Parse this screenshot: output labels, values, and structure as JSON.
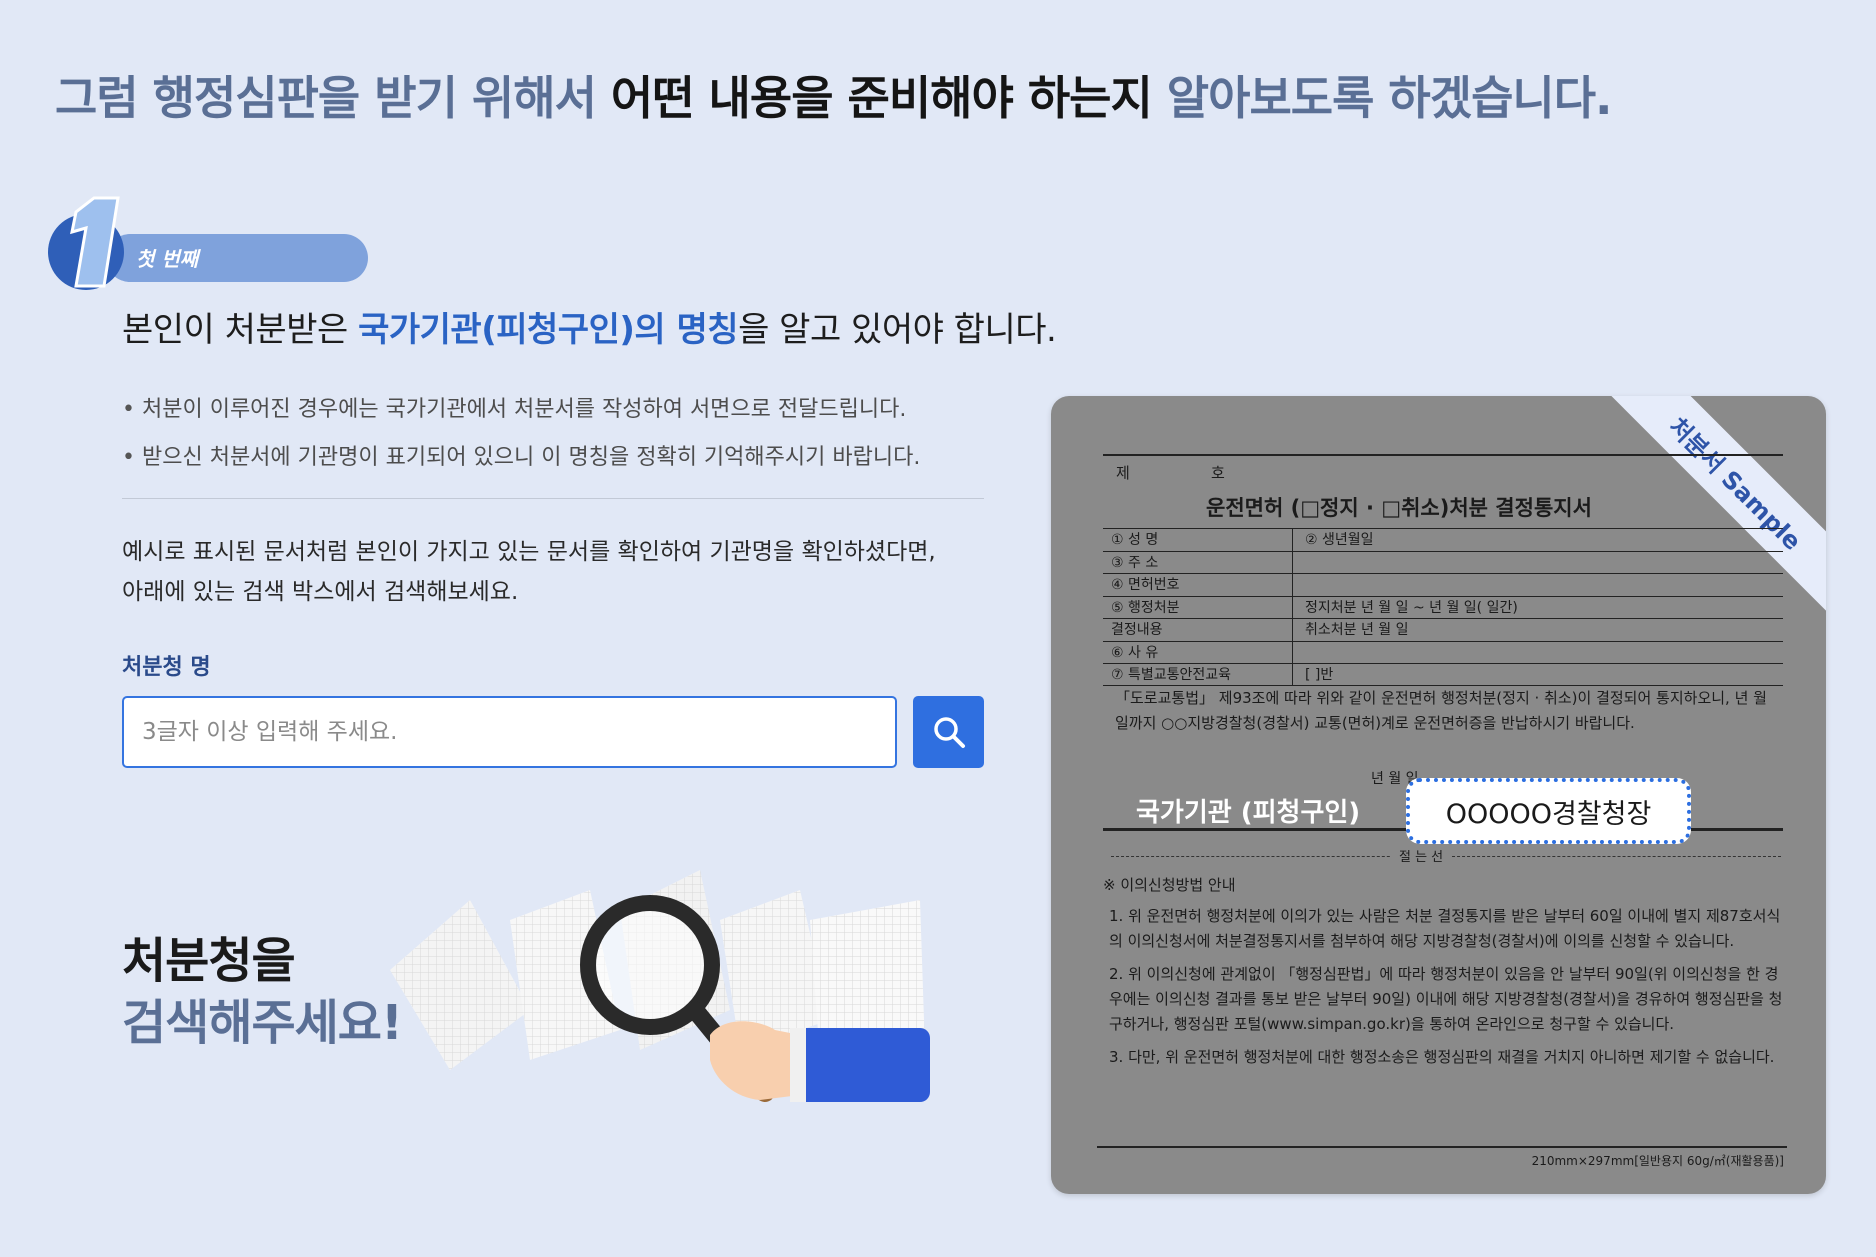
{
  "headline": {
    "part1": "그럼 행정심판을 받기 위해서 ",
    "part2": "어떤 내용을 준비해야 하는지",
    "part3": " 알아보도록 하겠습니다."
  },
  "step": {
    "number": "1",
    "label": "첫 번째"
  },
  "lead": {
    "prefix": "본인이 처분받은 ",
    "highlight": "국가기관(피청구인)의 명칭",
    "suffix": "을 알고 있어야 합니다."
  },
  "bullets": [
    "처분이 이루어진 경우에는 국가기관에서 처분서를 작성하여 서면으로 전달드립니다.",
    "받으신 처분서에 기관명이 표기되어 있으니 이 명칭을 정확히 기억해주시기 바랍니다."
  ],
  "example_text": {
    "line1": "예시로 표시된 문서처럼 본인이 가지고 있는 문서를 확인하여 기관명을 확인하셨다면,",
    "line2": "아래에 있는 검색 박스에서 검색해보세요."
  },
  "search": {
    "label": "처분청 명",
    "placeholder": "3글자 이상 입력해 주세요.",
    "value": "",
    "button_icon": "search-icon"
  },
  "cta": {
    "line1": "처분청을",
    "line2": "검색해주세요!"
  },
  "sample": {
    "ribbon": "처분서 Sample",
    "doc_no": "제",
    "doc_ho": "호",
    "doc_title": "운전면허 (□정지 · □취소)처분 결정통지서",
    "rows": [
      {
        "c1": "① 성 명",
        "c2": "② 생년월일"
      },
      {
        "c1": "③ 주 소",
        "c2": ""
      },
      {
        "c1": "④ 면허번호",
        "c2": ""
      },
      {
        "c1": "⑤ 행정처분",
        "c2": "정지처분     년   월   일 ~   년   월   일(   일간)"
      },
      {
        "c1": "   결정내용",
        "c2": "취소처분     년   월   일"
      },
      {
        "c1": "⑥ 사 유",
        "c2": ""
      },
      {
        "c1": "⑦ 특별교통안전교육",
        "c2": "[          ]반"
      }
    ],
    "para": "「도로교통법」 제93조에 따라 위와 같이 운전면허 행정처분(정지 · 취소)이 결정되어 통지하오니,   년   월   일까지 ○○지방경찰청(경찰서) 교통(면허)계로 운전면허증을 반납하시기 바랍니다.",
    "year": "년   월   일",
    "agency_label": "국가기관 (피청구인)",
    "agency_value": "OOOOO경찰청장",
    "fold_label": "절 는 선",
    "guide_title": "※ 이의신청방법 안내",
    "guide": [
      "1. 위 운전면허 행정처분에 이의가 있는 사람은 처분 결정통지를 받은 날부터 60일 이내에 별지 제87호서식의 이의신청서에 처분결정통지서를 첨부하여 해당 지방경찰청(경찰서)에 이의를 신청할 수 있습니다.",
      "2. 위 이의신청에 관계없이 「행정심판법」에 따라 행정처분이 있음을 안 날부터 90일(위 이의신청을 한 경우에는 이의신청 결과를 통보 받은 날부터 90일) 이내에 해당 지방경찰청(경찰서)을 경유하여 행정심판을 청구하거나, 행정심판 포털(www.simpan.go.kr)을 통하여 온라인으로 청구할 수 있습니다.",
      "3. 다만, 위 운전면허 행정처분에 대한 행정소송은 행정심판의 재결을 거치지 아니하면 제기할 수 없습니다."
    ],
    "spec": "210mm×297mm[일반용지 60g/㎡(재활용품)]"
  },
  "colors": {
    "background": "#e1e8f6",
    "accent": "#2f6fe0",
    "highlight_text": "#2a63c4",
    "muted_heading": "#5a6f95"
  }
}
